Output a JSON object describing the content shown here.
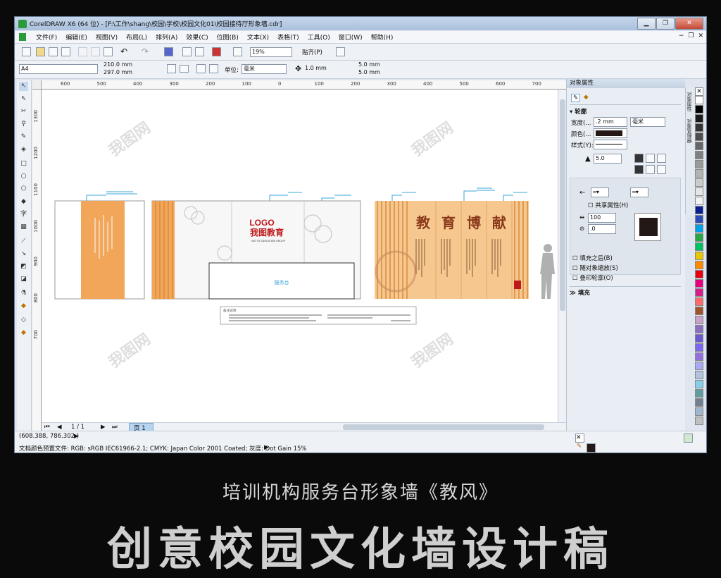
{
  "window": {
    "title": "CorelDRAW X6 (64 位) - [F:\\工作\\shang\\校园\\学校\\校园文化01\\校园接待厅形象墙.cdr]",
    "buttons": [
      "▁",
      "❐",
      "✕"
    ]
  },
  "menu": [
    "文件(F)",
    "编辑(E)",
    "视图(V)",
    "布局(L)",
    "排列(A)",
    "效果(C)",
    "位图(B)",
    "文本(X)",
    "表格(T)",
    "工具(O)",
    "窗口(W)",
    "帮助(H)"
  ],
  "toolbar": {
    "zoom": "19%",
    "snap": "贴齐(P)"
  },
  "propbar": {
    "page_size": "A4",
    "width": "210.0 mm",
    "height": "297.0 mm",
    "units_label": "单位:",
    "units": "毫米",
    "nudge": "1.0 mm",
    "dup_x": "5.0 mm",
    "dup_y": "5.0 mm"
  },
  "ruler": {
    "h_ticks": [
      "600",
      "500",
      "400",
      "300",
      "200",
      "100",
      "0",
      "100",
      "200",
      "300",
      "400",
      "500",
      "600",
      "700"
    ],
    "v_ticks": [
      "1300",
      "1200",
      "1100",
      "1000",
      "900",
      "800",
      "700"
    ]
  },
  "artwork": {
    "logo": "LOGO",
    "brand": "我图教育",
    "brand_sub": "WO TU EDUCATION GROUP",
    "desk_label": "服务台",
    "big_chars": [
      "教",
      "育",
      "博",
      "献"
    ],
    "notes_title": "备注说明:"
  },
  "nav": {
    "page_count": "1 / 1",
    "page_tab": "页 1"
  },
  "docker": {
    "title": "对象属性",
    "section_outline": "轮廓",
    "width_label": "宽度(...",
    "width_value": ".2 mm",
    "width_unit": "毫米",
    "color_label": "颜色(...",
    "style_label": "样式(Y):",
    "miter": "5.0",
    "share_attr": "共享属性(H)",
    "stretch": "100",
    "angle": ".0",
    "fill_after": "填充之后(B)",
    "scale_with": "随对象缩放(S)",
    "overprint": "叠印轮廓(O)",
    "section_fill": "填充",
    "side_tabs": [
      "对象属性",
      "对象管理器"
    ]
  },
  "status": {
    "coords": "(608.388, 786.302 )",
    "color_profile": "文档颜色预置文件: RGB: sRGB IEC61966-2.1; CMYK: Japan Color 2001 Coated; 灰度: Dot Gain 15%"
  },
  "palette": [
    "#ffffff",
    "#000000",
    "#1a1a1a",
    "#333333",
    "#4d4d4d",
    "#666666",
    "#808080",
    "#999999",
    "#b3b3b3",
    "#cccccc",
    "#e6e6e6",
    "#f2f2f2",
    "#0a1f8f",
    "#2a4db5",
    "#00a0e9",
    "#28a745",
    "#00c060",
    "#e8c800",
    "#ff8c00",
    "#e60012",
    "#e4007f",
    "#d31f8a",
    "#ff6a6a",
    "#a0522d",
    "#c8a0c8",
    "#8a6fbf",
    "#6a5acd",
    "#7b68ee",
    "#9370db",
    "#a9a9f5",
    "#b0c4de",
    "#87ceeb",
    "#5f9ea0",
    "#708090",
    "#9fb6cd",
    "#c0c0c0"
  ],
  "caption": {
    "line1": "培训机构服务台形象墙《教风》",
    "line2": "创意校园文化墙设计稿"
  }
}
